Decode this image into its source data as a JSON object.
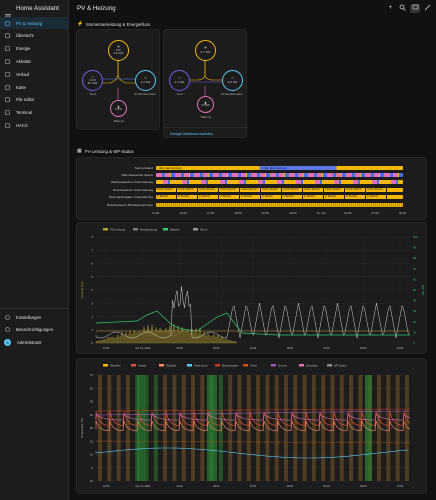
{
  "sidebar": {
    "title": "Home Assistant",
    "items": [
      {
        "label": "PV & Heizung",
        "icon": "solar-panel-icon",
        "active": true
      },
      {
        "label": "Übersicht",
        "icon": "home-icon"
      },
      {
        "label": "Energie",
        "icon": "lightning-icon"
      },
      {
        "label": "Aktivität",
        "icon": "list-icon"
      },
      {
        "label": "Verlauf",
        "icon": "chart-icon"
      },
      {
        "label": "Karte",
        "icon": "map-icon"
      },
      {
        "label": "File editor",
        "icon": "wrench-icon"
      },
      {
        "label": "Terminal",
        "icon": "terminal-icon"
      },
      {
        "label": "HACS",
        "icon": "hacs-icon"
      }
    ],
    "bottom": [
      {
        "label": "Einstellungen",
        "icon": "gear-icon"
      },
      {
        "label": "Benachrichtigungen",
        "icon": "bell-icon"
      },
      {
        "label": "Administrator",
        "icon": "avatar",
        "initial": "A"
      }
    ]
  },
  "header": {
    "title": "PV & Heizung"
  },
  "section1": {
    "title": "Momentanleistung & Energiefluss"
  },
  "flow1": {
    "solar": "9 W\n0.12 kW",
    "grid": "4.1 W\n51.2 kW",
    "home": "1.2 kW",
    "battery": "9.4 W",
    "labels": {
      "grid": "Netz",
      "home": "Einfamilienhaus",
      "battery": "Batterie"
    }
  },
  "flow2": {
    "solar": "0.7 kW",
    "grid": "4.1 kW",
    "home": "4.6 kW",
    "battery": "5.4 kW",
    "labels": {
      "grid": "Netz",
      "home": "Einfamilienhaus",
      "battery": "Batterie"
    },
    "link": "Energie Dashboard aufrufen"
  },
  "section2": {
    "title": "PV-Leistung & WP-Status"
  },
  "timeline": {
    "rows": [
      {
        "label": "Sonnenstand",
        "segments": [
          {
            "from": 0,
            "to": 0.42,
            "color": "#f5b700",
            "text": "Über dem Horizont"
          },
          {
            "from": 0.42,
            "to": 0.73,
            "color": "#5a79e6",
            "text": "Unter dem Horizont"
          },
          {
            "from": 0.73,
            "to": 1,
            "color": "#f5b700",
            "text": ""
          }
        ]
      },
      {
        "label": "Wärmetauscher Status",
        "pattern": "pink-blue"
      },
      {
        "label": "Wärmetauscher Unterstützung",
        "pattern": "yellow-pink"
      },
      {
        "label": "Brauchwasser Unterstützung",
        "pattern": "yellow-text",
        "text": "Außer Betrieb"
      },
      {
        "label": "Heizungsfreigabe Unterstützung",
        "pattern": "yellow-text",
        "text": "In Betrieb"
      },
      {
        "label": "Brauchwasser Zirkulationspumpe",
        "pattern": "yellow-dense"
      }
    ],
    "ticks": [
      "12:00",
      "14:00",
      "16:00",
      "18:00",
      "20:00",
      "22:00",
      "14. Apr.",
      "02:00",
      "04:00",
      "06:00"
    ]
  },
  "chart_power": {
    "legend": [
      "PV-Leistung",
      "Netzspeisung",
      "Batterie",
      "Strom"
    ],
    "ylabel_left": "Leistung (kW)",
    "ylabel_right": "SoC (%)",
    "yticks_left": [
      "0",
      "1",
      "2",
      "3",
      "4",
      "5",
      "6",
      "7",
      "8"
    ],
    "yticks_right": [
      "0",
      "10",
      "20",
      "30",
      "40",
      "50",
      "60",
      "70",
      "80",
      "90",
      "100"
    ],
    "xticks": [
      "12:00",
      "Apr 13, 2024",
      "12:00",
      "06:00",
      "12:00",
      "18:00",
      "00:00\nApr 14, 2024",
      "06:00",
      "12:00"
    ]
  },
  "chart_temp": {
    "legend": [
      "Aktuelles",
      "Vorlauf",
      "Rücklauf",
      "Außentemp.",
      "Brauchwasser",
      "Tacho",
      "Zimmer",
      "Zirkulation",
      "WP-Status"
    ],
    "ylabel": "Temperatur (°C)",
    "yticks": [
      "-10",
      "0",
      "10",
      "20",
      "30",
      "40",
      "50",
      "60",
      "70"
    ],
    "xticks": [
      "12:00",
      "Apr 13, 2024",
      "12:00",
      "06:00",
      "12:00",
      "18:00",
      "00:00\nApr 14, 2024",
      "06:00",
      "12:00"
    ]
  },
  "colors": {
    "accent": "#5ac8fa",
    "yellow": "#f5b700",
    "blue": "#4a6fe0",
    "pink": "#e36fb5",
    "green": "#2ecc71"
  }
}
